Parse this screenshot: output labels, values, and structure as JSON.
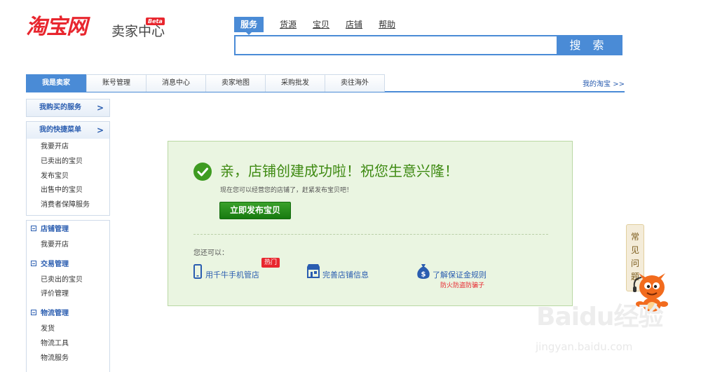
{
  "logo": {
    "main": "淘宝网",
    "sub": "卖家中心",
    "badge": "Beta"
  },
  "search": {
    "tabs": [
      "服务",
      "货源",
      "宝贝",
      "店铺",
      "帮助"
    ],
    "value": "",
    "button": "搜 索"
  },
  "nav": {
    "tabs": [
      "我是卖家",
      "账号管理",
      "消息中心",
      "卖家地图",
      "采购批发",
      "卖往海外"
    ],
    "right_link": "我的淘宝 >>"
  },
  "sidebar": {
    "bought_services": {
      "title": "我购买的服务",
      "arrow": ">"
    },
    "quick_menu": {
      "title": "我的快捷菜单",
      "arrow": ">",
      "items": [
        "我要开店",
        "已卖出的宝贝",
        "发布宝贝",
        "出售中的宝贝",
        "消费者保障服务"
      ]
    },
    "groups": [
      {
        "title": "店铺管理",
        "items": [
          "我要开店"
        ]
      },
      {
        "title": "交易管理",
        "items": [
          "已卖出的宝贝",
          "评价管理"
        ]
      },
      {
        "title": "物流管理",
        "items": [
          "发货",
          "物流工具",
          "物流服务"
        ]
      }
    ]
  },
  "success": {
    "title": "亲，店铺创建成功啦！祝您生意兴隆！",
    "subtitle": "现在您可以经营您的店铺了，赶紧发布宝贝吧！",
    "button": "立即发布宝贝",
    "also_label": "您还可以：",
    "actions": [
      {
        "label": "用千牛手机管店",
        "badge": "热门",
        "icon": "phone-icon"
      },
      {
        "label": "完善店铺信息",
        "icon": "shop-icon"
      },
      {
        "label": "了解保证金规则",
        "note": "防火防盗防骗子",
        "icon": "money-bag-icon"
      }
    ]
  },
  "faq": {
    "chars": [
      "常",
      "见",
      "问",
      "题"
    ]
  },
  "watermark": {
    "logo": "Baidu经验",
    "url": "jingyan.baidu.com"
  },
  "colors": {
    "brand_red": "#e8262e",
    "accent_blue": "#4a8bd6",
    "success_green": "#3e8a12",
    "panel_bg": "#eaf5e1"
  }
}
